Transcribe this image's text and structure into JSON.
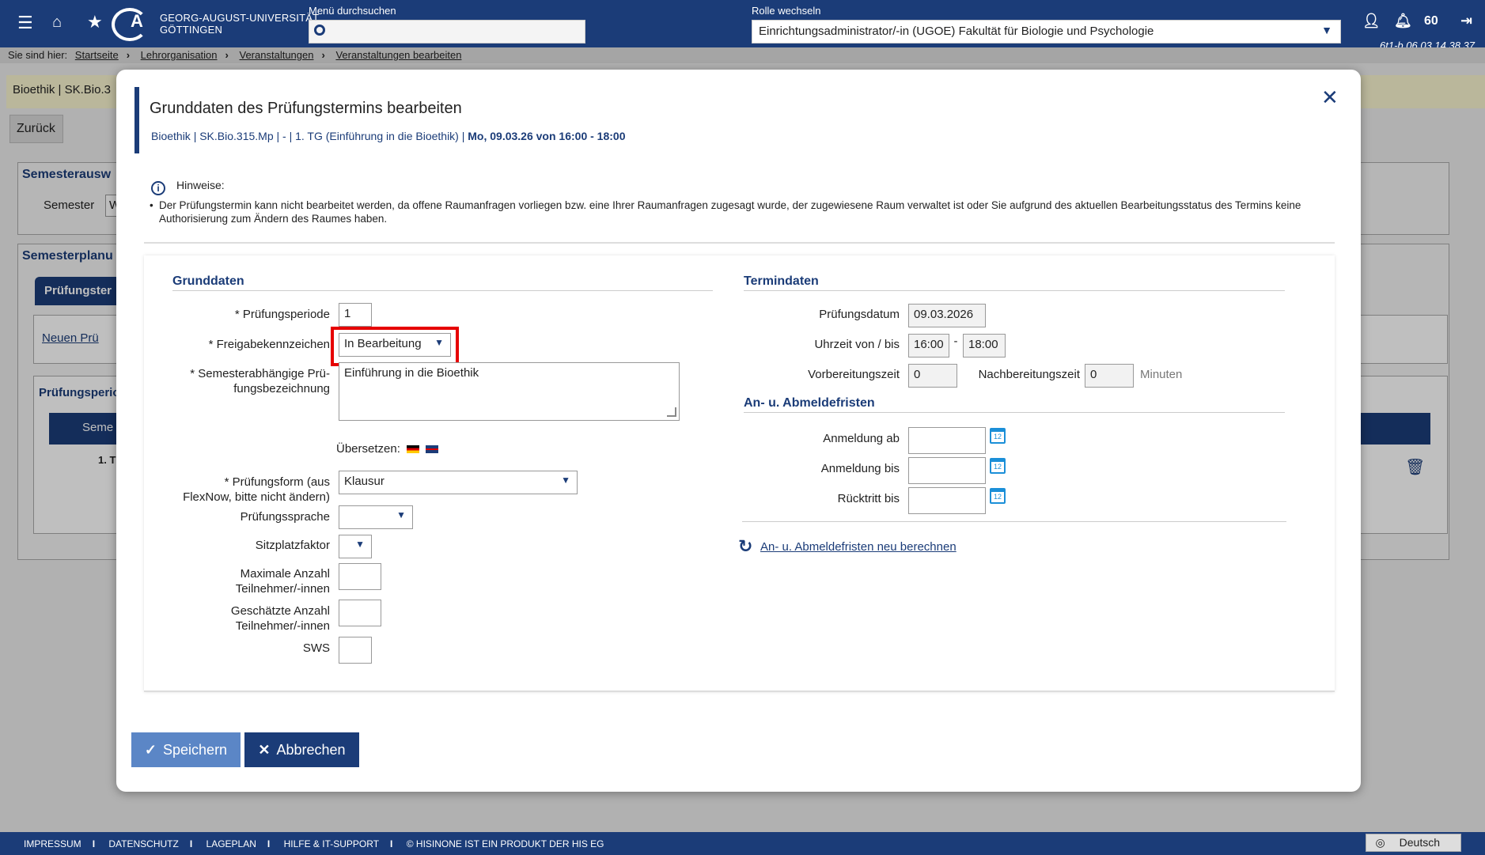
{
  "header": {
    "university_line1": "GEORG-AUGUST-UNIVERSITÄT",
    "university_line2": "GÖTTINGEN",
    "menu_search_label": "Menü durchsuchen",
    "role_label": "Rolle wechseln",
    "role_value": "Einrichtungsadministrator/-in (UGOE) Fakultät für Biologie und Psychologie",
    "notifications_count": "60",
    "version": "6t1-b.06.03.14.38.37"
  },
  "breadcrumb": {
    "prefix": "Sie sind hier:",
    "items": [
      "Startseite",
      "Lehrorganisation",
      "Veranstaltungen",
      "Veranstaltungen bearbeiten"
    ]
  },
  "background": {
    "course_bar": "Bioethik | SK.Bio.3",
    "back_button": "Zurück",
    "semester_panel_title": "Semesterausw",
    "semester_label": "Semester",
    "semester_value": "W",
    "semesterplan_title": "Semesterplanu",
    "tab_label": "Prüfungster",
    "new_button": "Neuen Prü",
    "periods_title": "Prüfungsperio",
    "table_col": "Seme",
    "row_value": "1. T"
  },
  "modal": {
    "title": "Grunddaten des Prüfungstermins bearbeiten",
    "subtitle_plain": "Bioethik | SK.Bio.315.Mp | - | 1. TG (Einführung in die Bioethik) | ",
    "subtitle_bold": "Mo, 09.03.26 von 16:00 - 18:00",
    "notice_head": "Hinweise:",
    "notice_text": "Der Prüfungstermin kann nicht bearbeitet werden, da offene Raumanfragen vorliegen bzw. eine Ihrer Raumanfragen zugesagt wurde, der zugewiesene Raum verwaltet ist oder Sie aufgrund des aktuellen Bearbeitungsstatus des Termins keine Authorisierung zum Ändern des Raumes haben."
  },
  "grunddaten": {
    "heading": "Grunddaten",
    "pruefungsperiode_label": "* Prüfungsperiode",
    "pruefungsperiode_value": "1",
    "freigabe_label": "* Freigabekennzeichen",
    "freigabe_value": "In Bearbeitung",
    "bezeichnung_label_1": "* Semesterabhängige Prü-",
    "bezeichnung_label_2": "fungsbezeichnung",
    "bezeichnung_value": "Einführung in die Bioethik",
    "uebersetzen_label": "Übersetzen:",
    "pruefungsform_label_1": "* Prüfungsform (aus",
    "pruefungsform_label_2": "FlexNow, bitte nicht ändern)",
    "pruefungsform_value": "Klausur",
    "sprache_label": "Prüfungssprache",
    "sprache_value": "",
    "sitzplatz_label": "Sitzplatzfaktor",
    "sitzplatz_value": "",
    "max_label_1": "Maximale Anzahl",
    "max_label_2": "Teilnehmer/-innen",
    "max_value": "",
    "geschaetzt_label_1": "Geschätzte Anzahl",
    "geschaetzt_label_2": "Teilnehmer/-innen",
    "geschaetzt_value": "",
    "sws_label": "SWS",
    "sws_value": ""
  },
  "termindaten": {
    "heading": "Termindaten",
    "datum_label": "Prüfungsdatum",
    "datum_value": "09.03.2026",
    "uhrzeit_label": "Uhrzeit von / bis",
    "von_value": "16:00",
    "dash": "-",
    "bis_value": "18:00",
    "vorbereitung_label": "Vorbereitungszeit",
    "vorbereitung_value": "0",
    "nachbereitung_label": "Nachbereitungszeit",
    "nachbereitung_value": "0",
    "minuten": "Minuten"
  },
  "fristen": {
    "heading": "An- u. Abmeldefristen",
    "anmeldung_ab_label": "Anmeldung ab",
    "anmeldung_ab_value": "",
    "anmeldung_bis_label": "Anmeldung bis",
    "anmeldung_bis_value": "",
    "ruecktritt_label": "Rücktritt bis",
    "ruecktritt_value": "",
    "recalc_link": "An- u. Abmeldefristen neu berechnen",
    "cal_day": "12"
  },
  "buttons": {
    "save": "Speichern",
    "cancel": "Abbrechen"
  },
  "footer": {
    "items": [
      "IMPRESSUM",
      "DATENSCHUTZ",
      "LAGEPLAN",
      "HILFE & IT-SUPPORT",
      "© HISINONE IST EIN PRODUKT DER HIS EG"
    ],
    "language": "Deutsch"
  }
}
